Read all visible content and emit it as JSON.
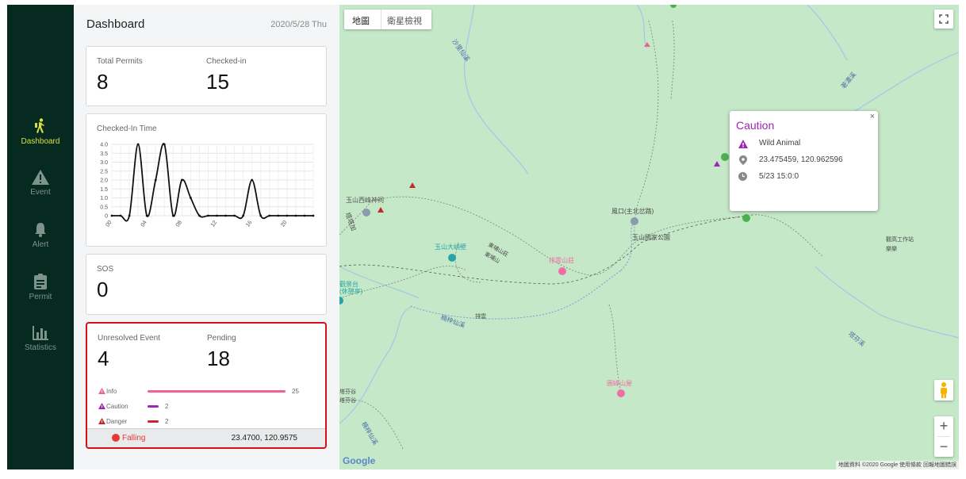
{
  "sidebar": {
    "items": [
      {
        "label": "Dashboard",
        "icon": "hiker-icon",
        "active": true
      },
      {
        "label": "Event",
        "icon": "warning-icon",
        "active": false
      },
      {
        "label": "Alert",
        "icon": "bell-icon",
        "active": false
      },
      {
        "label": "Permit",
        "icon": "clipboard-icon",
        "active": false
      },
      {
        "label": "Statistics",
        "icon": "bar-chart-icon",
        "active": false
      }
    ]
  },
  "dashboard": {
    "title": "Dashboard",
    "date": "2020/5/28 Thu"
  },
  "permits": {
    "total_label": "Total Permits",
    "total_value": "8",
    "checked_label": "Checked-in",
    "checked_value": "15"
  },
  "chart_data": {
    "type": "line",
    "title": "Checked-In Time",
    "x": [
      0,
      1,
      2,
      3,
      4,
      5,
      6,
      7,
      8,
      9,
      10,
      11,
      12,
      13,
      14,
      15,
      16,
      17,
      18,
      19,
      20,
      21,
      22,
      23
    ],
    "xtick_labels": [
      "00",
      "04",
      "08",
      "12",
      "16",
      "20"
    ],
    "ytick_labels": [
      "0",
      "0.5",
      "1.0",
      "1.5",
      "2.0",
      "2.5",
      "3.0",
      "3.5",
      "4.0"
    ],
    "series": [
      {
        "values": [
          0,
          0,
          0,
          4,
          0,
          2,
          4,
          0,
          2,
          1,
          0,
          0,
          0,
          0,
          0,
          0,
          2,
          0,
          0,
          0,
          0,
          0,
          0,
          0
        ]
      }
    ],
    "ylim": [
      0,
      4
    ],
    "grid": true,
    "smooth": true
  },
  "sos": {
    "label": "SOS",
    "value": "0"
  },
  "events": {
    "unresolved_label": "Unresolved Event",
    "unresolved_value": "4",
    "pending_label": "Pending",
    "pending_value": "18",
    "breakdown": [
      {
        "name": "Info",
        "count": 25,
        "color": "#f06292"
      },
      {
        "name": "Caution",
        "count": 2,
        "color": "#9c27b0"
      },
      {
        "name": "Danger",
        "count": 2,
        "color": "#c62828"
      }
    ],
    "footer_status": "Falling",
    "footer_status_color": "#e53935",
    "footer_coords": "23.4700, 120.9575"
  },
  "map": {
    "type_controls": [
      "地圖",
      "衛星檢視"
    ],
    "labels": [
      "沙里仙溪",
      "玉山西峰神祠",
      "塔塔加",
      "塔塔加遊憩區",
      "塔塔加",
      "玉山大峭壁",
      "東埔山莊",
      "東埔山",
      "排雲山莊",
      "玉山國家公園",
      "風口(主北岔路)",
      "觀高工作站",
      "樂樂",
      "排雲",
      "荖濃溪",
      "楠梓仙溪",
      "圓峰山屋",
      "楠梓仙溪",
      "塔芬溪",
      "塔芬谷",
      "塔芬谷",
      "觀景台",
      "(休憩亭)"
    ],
    "attribution": "地圖資料 ©2020 Google  使用條款  回報地圖錯誤",
    "google": "Google",
    "zoom_in": "+",
    "zoom_out": "−"
  },
  "popup": {
    "title": "Caution",
    "close": "×",
    "type": "Wild Animal",
    "coords": "23.475459, 120.962596",
    "time": "5/23 15:0:0"
  }
}
